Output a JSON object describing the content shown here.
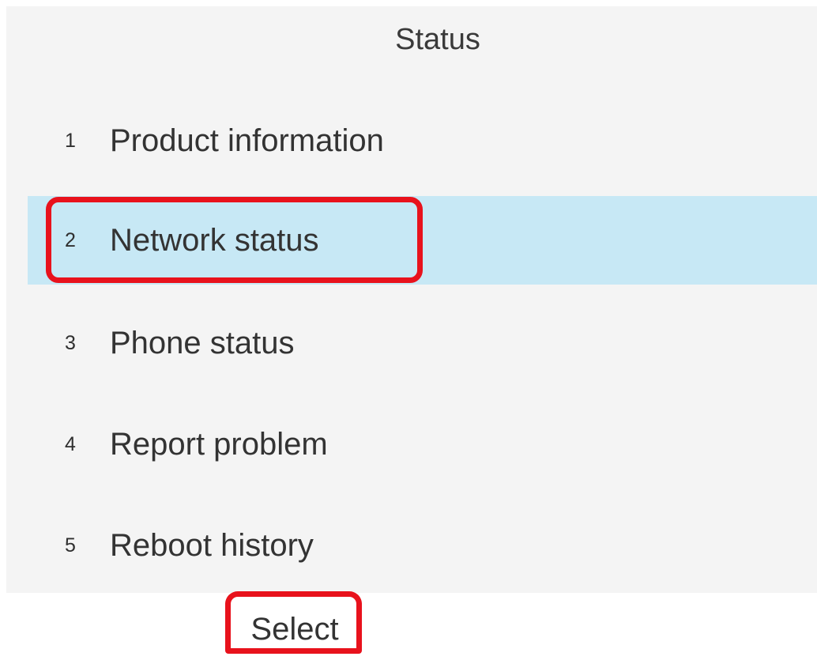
{
  "screen": {
    "title": "Status"
  },
  "menu": {
    "items": [
      {
        "number": "1",
        "label": "Product information",
        "selected": false
      },
      {
        "number": "2",
        "label": "Network status",
        "selected": true
      },
      {
        "number": "3",
        "label": "Phone status",
        "selected": false
      },
      {
        "number": "4",
        "label": "Report problem",
        "selected": false
      },
      {
        "number": "5",
        "label": "Reboot history",
        "selected": false
      }
    ]
  },
  "softkeys": {
    "select_label": "Select"
  },
  "colors": {
    "screen_background": "#f4f4f4",
    "selected_row": "#c7e8f5",
    "highlight_annotation": "#e8121c",
    "text": "#333333"
  }
}
